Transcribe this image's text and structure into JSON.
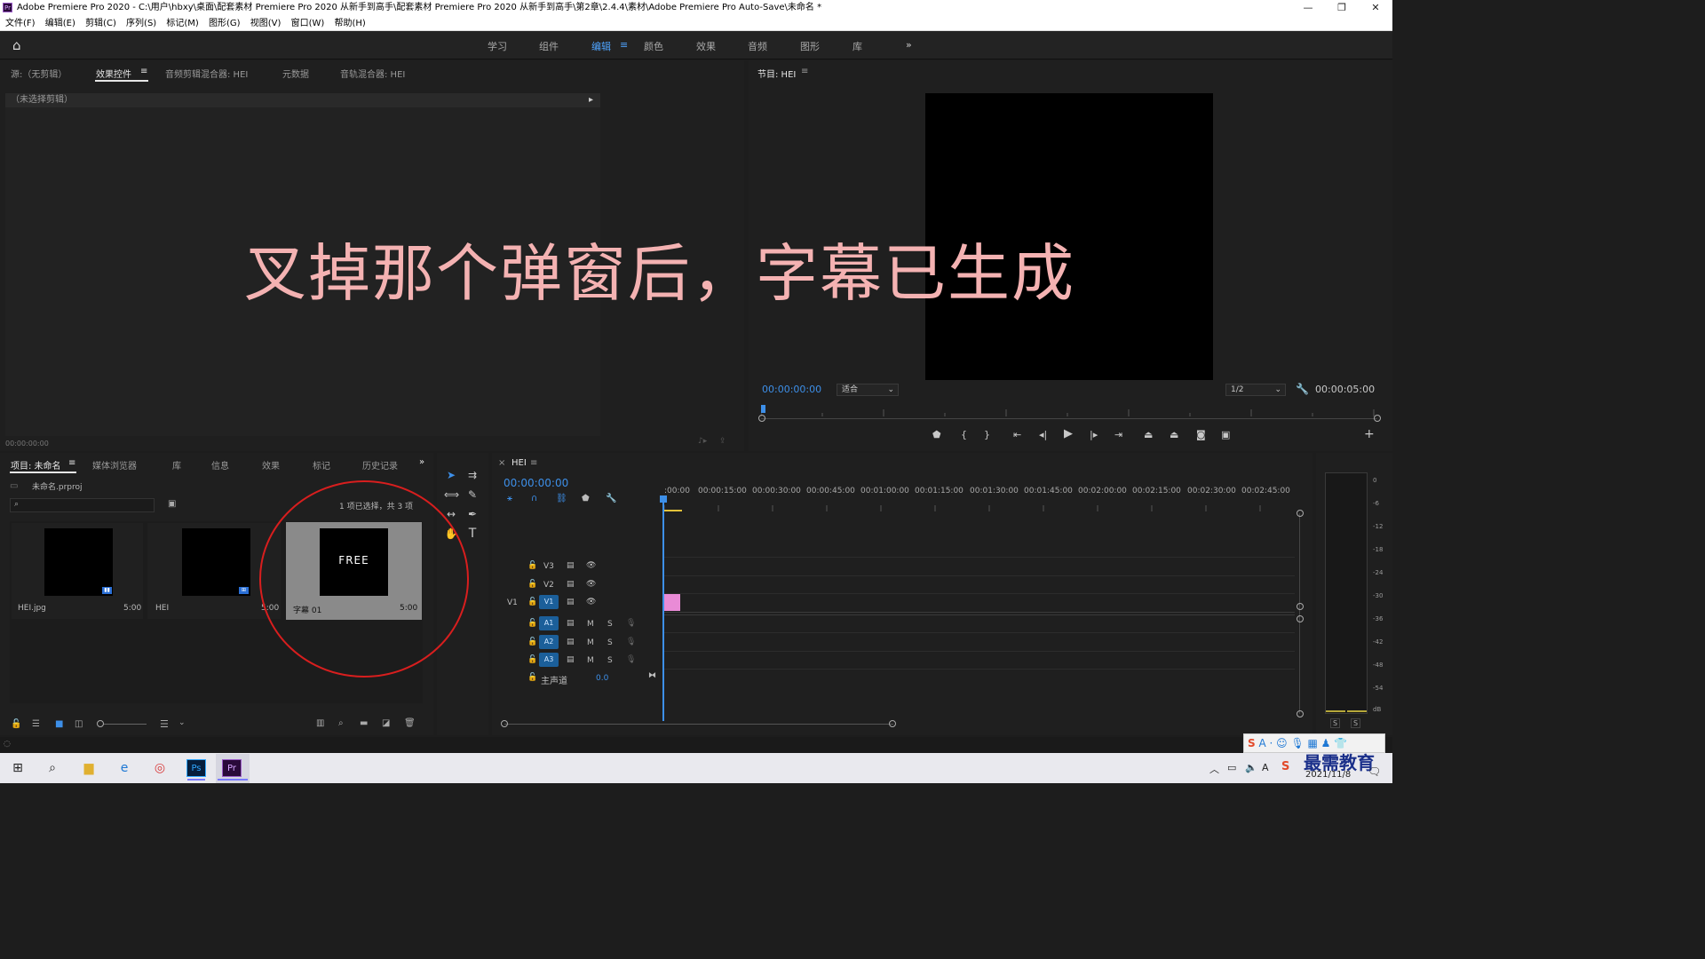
{
  "window": {
    "title": "Adobe Premiere Pro 2020 - C:\\用户\\hbxy\\桌面\\配套素材 Premiere Pro 2020 从新手到高手\\配套素材 Premiere Pro 2020 从新手到高手\\第2章\\2.4.4\\素材\\Adobe Premiere Pro Auto-Save\\未命名 *",
    "app_icon": "Pr",
    "minimize": "—",
    "restore": "❐",
    "close": "✕"
  },
  "menu": [
    "文件(F)",
    "编辑(E)",
    "剪辑(C)",
    "序列(S)",
    "标记(M)",
    "图形(G)",
    "视图(V)",
    "窗口(W)",
    "帮助(H)"
  ],
  "workspaces": {
    "items": [
      "学习",
      "组件",
      "编辑",
      "颜色",
      "效果",
      "音频",
      "图形",
      "库"
    ],
    "active": "编辑",
    "more": "»"
  },
  "source_panel": {
    "tabs": [
      "源:（无剪辑）",
      "效果控件",
      "音频剪辑混合器: HEI",
      "元数据",
      "音轨混合器: HEI"
    ],
    "active_tab_menu": "≡",
    "no_clip_text": "（未选择剪辑）",
    "timecode": "00:00:00:00"
  },
  "program_monitor": {
    "title": "节目: HEI",
    "menu": "≡",
    "current_time": "00:00:00:00",
    "fit": "适合",
    "resolution": "1/2",
    "duration": "00:00:05:00"
  },
  "overlay_caption": "叉掉那个弹窗后，字幕已生成",
  "project_panel": {
    "tabs": [
      "项目: 未命名",
      "媒体浏览器",
      "库",
      "信息",
      "效果",
      "标记",
      "历史记录"
    ],
    "more": "»",
    "project_file": "未命名.prproj",
    "search_placeholder": "",
    "selection_info": "1 项已选择，共 3 项",
    "items": [
      {
        "name": "HEI.jpg",
        "duration": "5:00"
      },
      {
        "name": "HEI",
        "duration": "5:00"
      },
      {
        "name": "字幕 01",
        "duration": "5:00",
        "thumb_text": "FREE"
      }
    ]
  },
  "timeline": {
    "sequence_name": "HEI",
    "close": "×",
    "menu": "≡",
    "timecode": "00:00:00:00",
    "ruler": [
      ":00:00",
      "00:00:15:00",
      "00:00:30:00",
      "00:00:45:00",
      "00:01:00:00",
      "00:01:15:00",
      "00:01:30:00",
      "00:01:45:00",
      "00:02:00:00",
      "00:02:15:00",
      "00:02:30:00",
      "00:02:45:00"
    ],
    "video_tracks": [
      "V3",
      "V2",
      "V1"
    ],
    "audio_tracks": [
      "A1",
      "A2",
      "A3"
    ],
    "source_patch_v": "V1",
    "mute": "M",
    "solo": "S",
    "master_label": "主声道",
    "master_value": "0.0"
  },
  "audio_meter": {
    "scale": [
      "0",
      "-6",
      "-12",
      "-18",
      "-24",
      "-30",
      "-36",
      "-42",
      "-48",
      "-54",
      "dB"
    ],
    "solo_left": "S",
    "solo_right": "S"
  },
  "taskbar": {
    "date": "2021/11/8",
    "watermark": "最需教育",
    "ime": "S"
  },
  "colors": {
    "accent_blue": "#3d8fe8",
    "caption_pink": "#f4b2b2",
    "clip_pink": "#e98bd6",
    "highlight_circle": "#d81e1e"
  }
}
